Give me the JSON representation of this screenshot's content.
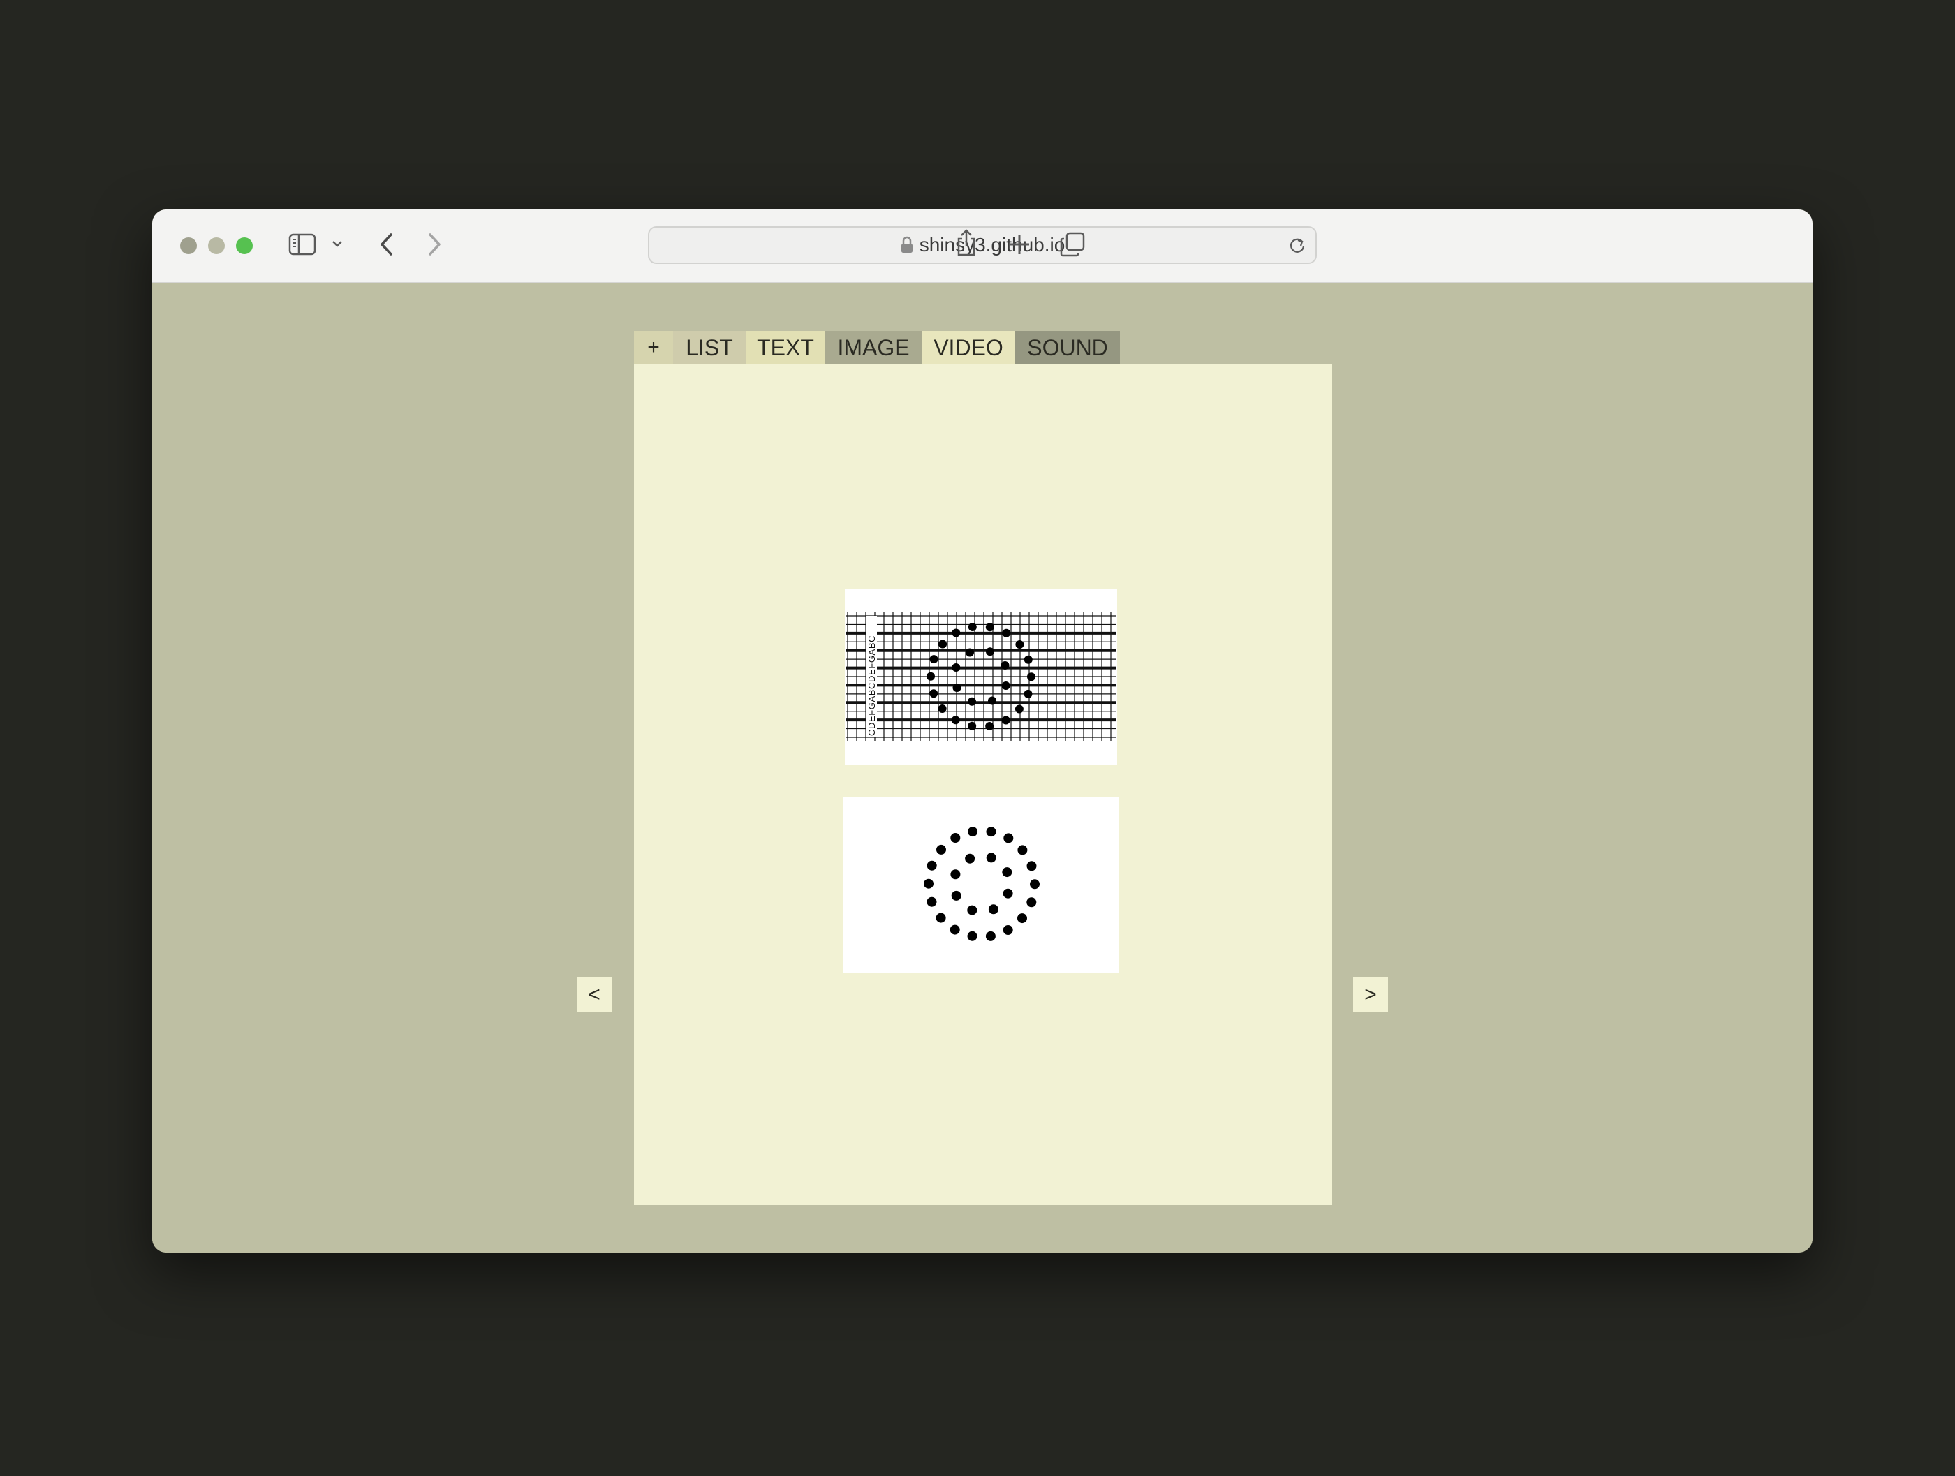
{
  "browser": {
    "url": "shinsy3.github.io",
    "icons": [
      "sidebar-icon",
      "chevron-down-icon",
      "back-icon",
      "forward-icon",
      "lock-icon",
      "reload-icon",
      "share-icon",
      "plus-icon",
      "tabs-icon"
    ]
  },
  "tabs": {
    "plus": "+",
    "list": "LIST",
    "text": "TEXT",
    "image": "IMAGE",
    "video": "VIDEO",
    "sound": "SOUND"
  },
  "nav": {
    "prev": "<",
    "next": ">"
  },
  "colors": {
    "page_bg": "#bebfa3",
    "panel_bg": "#f2f2d4",
    "tab_image": "#a9aa90",
    "tab_sound": "#959781"
  },
  "cards": [
    {
      "kind": "score-image",
      "staff_letters": "CDEFGABCDEFGABC"
    },
    {
      "kind": "dot-pattern-image"
    }
  ]
}
